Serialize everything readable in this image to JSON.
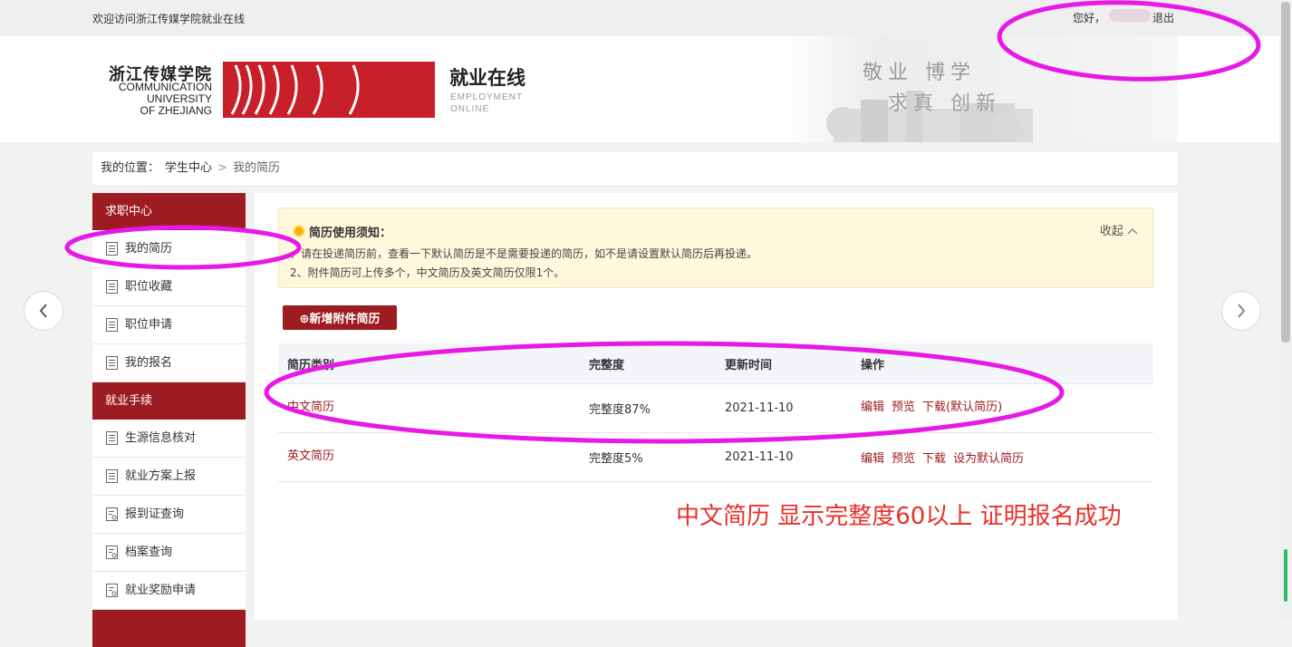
{
  "topbar": {
    "welcome": "欢迎访问浙江传媒学院就业在线",
    "greeting": "您好，",
    "logout": "退出"
  },
  "header": {
    "logo_cn": "浙江传媒学院",
    "logo_en": [
      "COMMUNICATION",
      "UNIVERSITY",
      "OF ZHEJIANG"
    ],
    "site_title": "就业在线",
    "site_subtitle": [
      "EMPLOYMENT",
      "ONLINE"
    ],
    "motto_line1": "敬业 博学",
    "motto_line2": "求真 创新"
  },
  "breadcrumb": {
    "label": "我的位置：",
    "link": "学生中心",
    "separator": ">",
    "current": "我的简历"
  },
  "sidebar": {
    "section1": "求职中心",
    "items1": [
      "我的简历",
      "职位收藏",
      "职位申请",
      "我的报名"
    ],
    "section2": "就业手续",
    "items2": [
      "生源信息核对",
      "就业方案上报",
      "报到证查询",
      "档案查询",
      "就业奖励申请"
    ]
  },
  "notice": {
    "title": "简历使用须知：",
    "line1": "、请在投递简历前，查看一下默认简历是不是需要投递的简历，如不是请设置默认简历后再投递。",
    "line2": "2、附件简历可上传多个，中文简历及英文简历仅限1个。",
    "collapse": "收起"
  },
  "add_button": "⊕新增附件简历",
  "table": {
    "headers": [
      "简历类别",
      "完整度",
      "更新时间",
      "操作"
    ],
    "rows": [
      {
        "type": "中文简历",
        "completeness": "完整度87%",
        "updated": "2021-11-10",
        "ops": [
          "编辑",
          "预览",
          "下载(默认简历)"
        ]
      },
      {
        "type": "英文简历",
        "completeness": "完整度5%",
        "updated": "2021-11-10",
        "ops": [
          "编辑",
          "预览",
          "下载",
          "设为默认简历"
        ]
      }
    ]
  },
  "annotation": "中文简历 显示完整度60以上 证明报名成功",
  "colors": {
    "brand_red": "#9d1c22",
    "annotation_magenta": "#e619e6",
    "annotation_text": "#e8302a"
  }
}
